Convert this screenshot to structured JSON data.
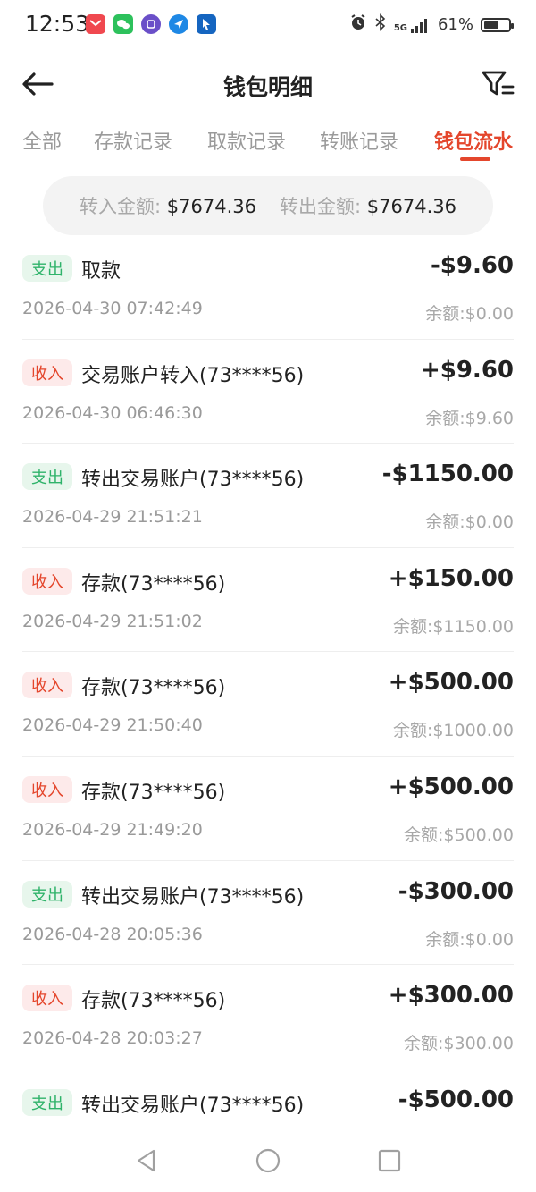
{
  "status_bar": {
    "time": "12:53",
    "battery": "61%",
    "battery_level": 0.61,
    "app_icons": [
      "notification-red-icon",
      "wechat-icon",
      "app-purple-icon",
      "app-blue-icon",
      "app-blue-cursor-icon"
    ],
    "sys_icons": [
      "alarm-icon",
      "bluetooth-icon",
      "signal-5g-icon"
    ],
    "signal_label": "5G"
  },
  "header": {
    "title": "钱包明细"
  },
  "tabs": [
    {
      "label": "全部",
      "active": false
    },
    {
      "label": "存款记录",
      "active": false
    },
    {
      "label": "取款记录",
      "active": false
    },
    {
      "label": "转账记录",
      "active": false
    },
    {
      "label": "钱包流水",
      "active": true
    }
  ],
  "summary": {
    "in_label": "转入金额:",
    "in_value": "$7674.36",
    "out_label": "转出金额:",
    "out_value": "$7674.36"
  },
  "transactions": [
    {
      "type": "支出",
      "kind": "out",
      "title": "取款",
      "amount": "-$9.60",
      "time": "2026-04-30 07:42:49",
      "balance": "余额:$0.00"
    },
    {
      "type": "收入",
      "kind": "in",
      "title": "交易账户转入(73****56)",
      "amount": "+$9.60",
      "time": "2026-04-30 06:46:30",
      "balance": "余额:$9.60"
    },
    {
      "type": "支出",
      "kind": "out",
      "title": "转出交易账户(73****56)",
      "amount": "-$1150.00",
      "time": "2026-04-29 21:51:21",
      "balance": "余额:$0.00"
    },
    {
      "type": "收入",
      "kind": "in",
      "title": "存款(73****56)",
      "amount": "+$150.00",
      "time": "2026-04-29 21:51:02",
      "balance": "余额:$1150.00"
    },
    {
      "type": "收入",
      "kind": "in",
      "title": "存款(73****56)",
      "amount": "+$500.00",
      "time": "2026-04-29 21:50:40",
      "balance": "余额:$1000.00"
    },
    {
      "type": "收入",
      "kind": "in",
      "title": "存款(73****56)",
      "amount": "+$500.00",
      "time": "2026-04-29 21:49:20",
      "balance": "余额:$500.00"
    },
    {
      "type": "支出",
      "kind": "out",
      "title": "转出交易账户(73****56)",
      "amount": "-$300.00",
      "time": "2026-04-28 20:05:36",
      "balance": "余额:$0.00"
    },
    {
      "type": "收入",
      "kind": "in",
      "title": "存款(73****56)",
      "amount": "+$300.00",
      "time": "2026-04-28 20:03:27",
      "balance": "余额:$300.00"
    },
    {
      "type": "支出",
      "kind": "out",
      "title": "转出交易账户(73****56)",
      "amount": "-$500.00",
      "time": "",
      "balance": ""
    }
  ],
  "colors": {
    "accent": "#e4462c",
    "out_badge_bg": "#e7f6ec",
    "out_badge_fg": "#2fb36a",
    "in_badge_bg": "#fdeaea",
    "in_badge_fg": "#e4462c"
  },
  "nav": [
    "back-triangle-icon",
    "home-circle-icon",
    "recents-square-icon"
  ]
}
